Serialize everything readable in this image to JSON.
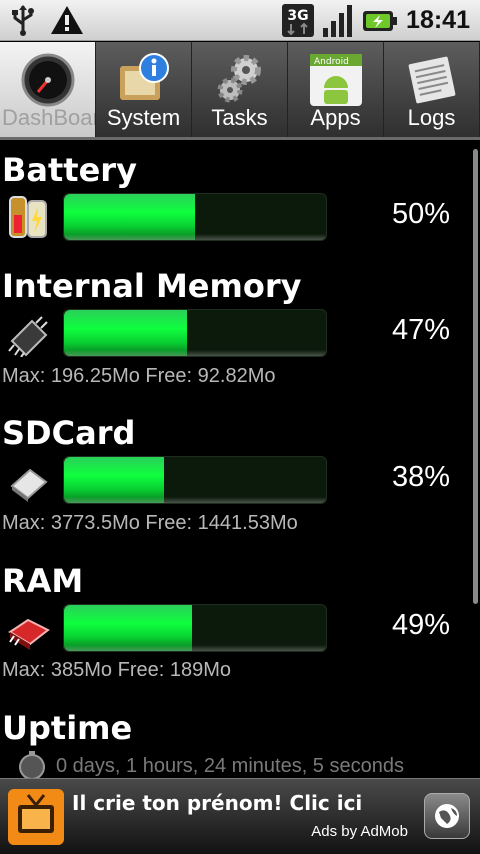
{
  "status_bar": {
    "time": "18:41",
    "network_label": "3G",
    "icons": [
      "usb-icon",
      "warning-icon",
      "3g-icon",
      "signal-icon",
      "battery-charging-icon"
    ]
  },
  "tabs": [
    {
      "label": "DashBoard",
      "icon": "gauge-icon",
      "active": true
    },
    {
      "label": "System",
      "icon": "info-icon",
      "active": false
    },
    {
      "label": "Tasks",
      "icon": "gears-icon",
      "active": false
    },
    {
      "label": "Apps",
      "icon": "android-icon",
      "active": false,
      "icon_badge": "Android"
    },
    {
      "label": "Logs",
      "icon": "newspaper-icon",
      "active": false
    }
  ],
  "sections": {
    "battery": {
      "title": "Battery",
      "percent_label": "50%",
      "percent": 50,
      "icon": "battery-icon"
    },
    "internal": {
      "title": "Internal Memory",
      "percent_label": "47%",
      "percent": 47,
      "icon": "chip-icon",
      "detail": "Max: 196.25Mo Free: 92.82Mo"
    },
    "sdcard": {
      "title": "SDCard",
      "percent_label": "38%",
      "percent": 38,
      "icon": "sdcard-icon",
      "detail": "Max: 3773.5Mo Free: 1441.53Mo"
    },
    "ram": {
      "title": "RAM",
      "percent_label": "49%",
      "percent": 49,
      "icon": "ram-icon",
      "detail": "Max: 385Mo Free: 189Mo"
    },
    "uptime": {
      "title": "Uptime",
      "icon": "stopwatch-icon",
      "detail": "0 days, 1 hours, 24 minutes, 5 seconds"
    }
  },
  "ad": {
    "text": "Il crie ton prénom! Clic ici",
    "by": "Ads by AdMob",
    "icon": "tv-icon",
    "globe_icon": "globe-icon"
  },
  "colors": {
    "bar_fill": "#0fff3e",
    "bar_track": "#0c1a0c",
    "accent": "#f28a16"
  }
}
